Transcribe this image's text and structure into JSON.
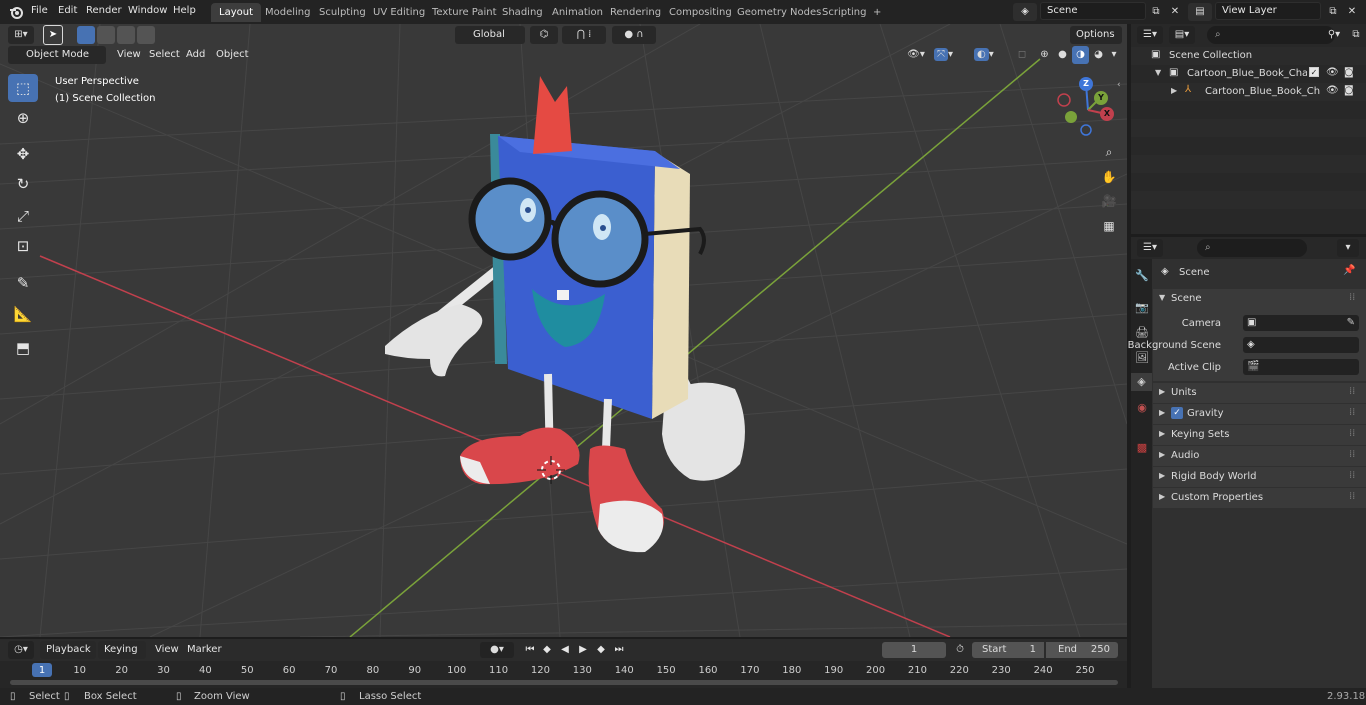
{
  "menu": {
    "file": "File",
    "edit": "Edit",
    "render": "Render",
    "window": "Window",
    "help": "Help"
  },
  "workspaces": [
    "Layout",
    "Modeling",
    "Sculpting",
    "UV Editing",
    "Texture Paint",
    "Shading",
    "Animation",
    "Rendering",
    "Compositing",
    "Geometry Nodes",
    "Scripting"
  ],
  "workspace_active": "Layout",
  "scene_field": "Scene",
  "view_layer_field": "View Layer",
  "viewport": {
    "mode": "Object Mode",
    "menus": [
      "View",
      "Select",
      "Add",
      "Object"
    ],
    "transform_orientation": "Global",
    "options": "Options",
    "perspective_label": "User Perspective",
    "collection_label": "(1) Scene Collection",
    "gizmo": {
      "x": "X",
      "y": "Y",
      "z": "Z"
    }
  },
  "outliner": {
    "scene_collection": "Scene Collection",
    "items": [
      {
        "label": "Cartoon_Blue_Book_Characte"
      },
      {
        "label": "Cartoon_Blue_Book_Cha"
      }
    ]
  },
  "properties": {
    "breadcrumb": "Scene",
    "panel_title": "Scene",
    "fields": [
      {
        "label": "Camera"
      },
      {
        "label": "Background Scene"
      },
      {
        "label": "Active Clip"
      }
    ],
    "subpanels": [
      "Units",
      "Gravity",
      "Keying Sets",
      "Audio",
      "Rigid Body World",
      "Custom Properties"
    ]
  },
  "timeline": {
    "menus": [
      "Playback",
      "Keying",
      "View",
      "Marker"
    ],
    "current_frame": "1",
    "start_label": "Start",
    "start_value": "1",
    "end_label": "End",
    "end_value": "250",
    "ticks": [
      "1",
      "10",
      "20",
      "30",
      "40",
      "50",
      "60",
      "70",
      "80",
      "90",
      "100",
      "110",
      "120",
      "130",
      "140",
      "150",
      "160",
      "170",
      "180",
      "190",
      "200",
      "210",
      "220",
      "230",
      "240",
      "250"
    ]
  },
  "statusbar": {
    "select": "Select",
    "box_select": "Box Select",
    "zoom_view": "Zoom View",
    "lasso_select": "Lasso Select",
    "version": "2.93.18"
  },
  "colors": {
    "accent": "#4772b3",
    "x_axis": "#c1404d",
    "y_axis": "#7aa23a",
    "z_axis": "#3f76d9"
  }
}
